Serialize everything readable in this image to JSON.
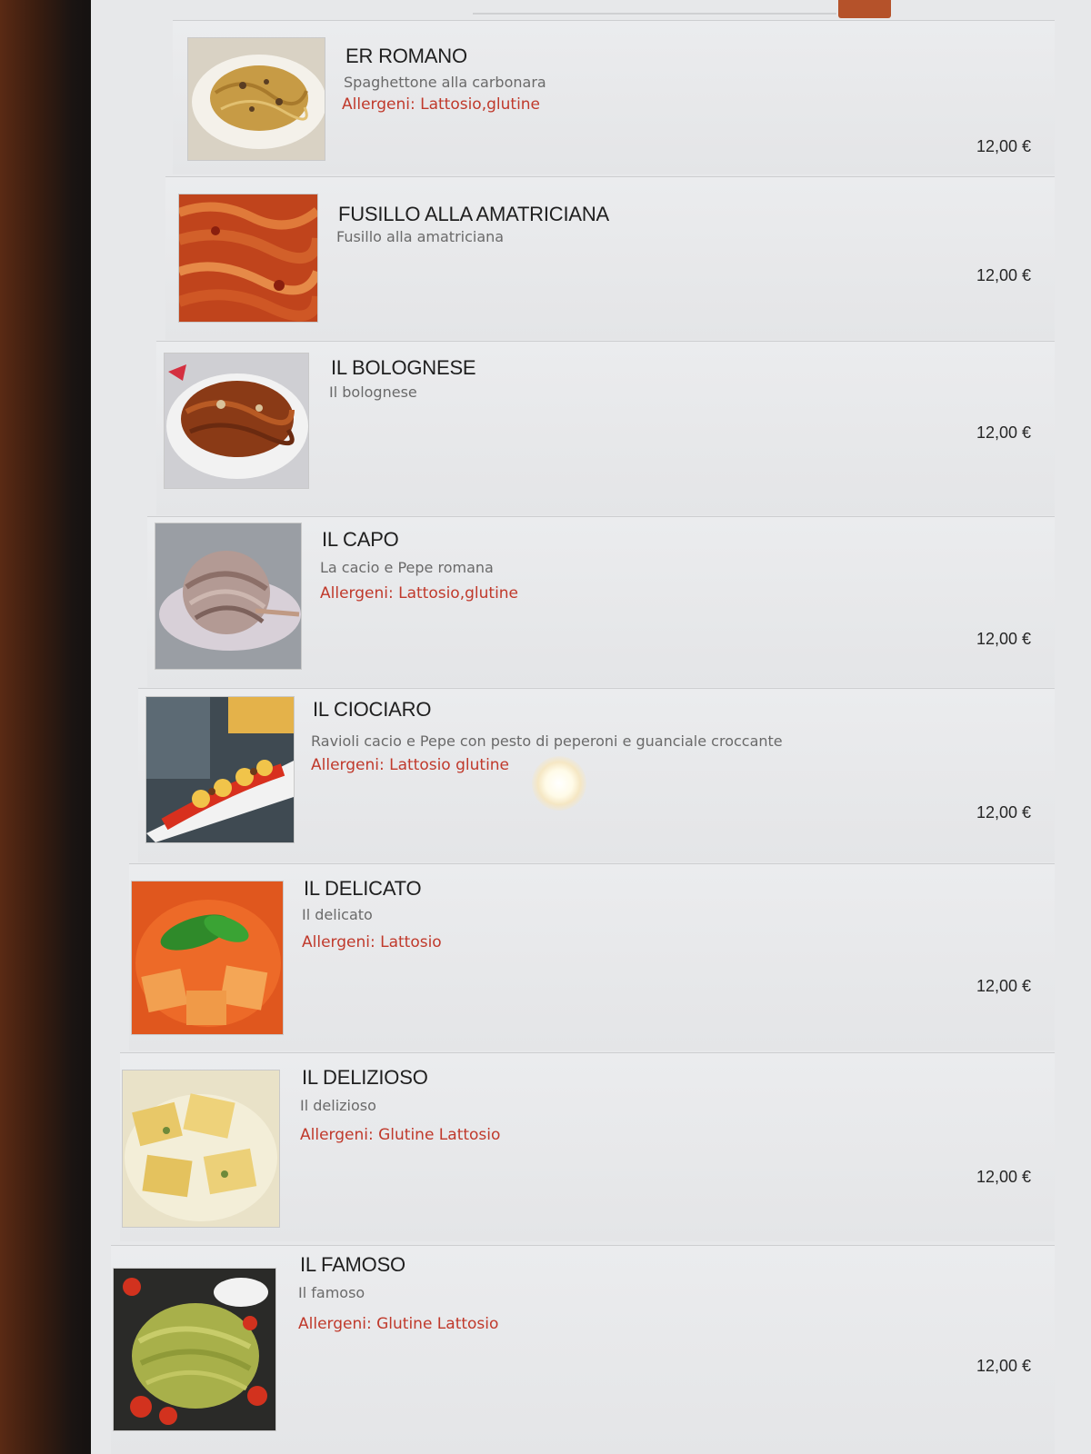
{
  "menu": {
    "items": [
      {
        "name": "ER ROMANO",
        "description": "Spaghettone alla carbonara",
        "allergens": "Allergeni: Lattosio,glutine",
        "price": "12,00 €",
        "image": "spaghetti-carbonara-photo"
      },
      {
        "name": "FUSILLO ALLA AMATRICIANA",
        "description": "Fusillo alla amatriciana",
        "allergens": "",
        "price": "12,00 €",
        "image": "fusilli-amatriciana-photo"
      },
      {
        "name": "IL BOLOGNESE",
        "description": "Il bolognese",
        "allergens": "",
        "price": "12,00 €",
        "image": "tagliatelle-bolognese-photo"
      },
      {
        "name": "IL CAPO",
        "description": "La cacio e Pepe romana",
        "allergens": "Allergeni: Lattosio,glutine",
        "price": "12,00 €",
        "image": "cacio-e-pepe-photo"
      },
      {
        "name": "IL CIOCIARO",
        "description": "Ravioli cacio e Pepe con pesto di peperoni e guanciale croccante",
        "allergens": "Allergeni: Lattosio glutine",
        "price": "12,00 €",
        "image": "ravioli-peperoni-photo"
      },
      {
        "name": "IL DELICATO",
        "description": "Il delicato",
        "allergens": "Allergeni: Lattosio",
        "price": "12,00 €",
        "image": "ravioli-tomato-basil-photo"
      },
      {
        "name": "IL DELIZIOSO",
        "description": "Il delizioso",
        "allergens": "Allergeni: Glutine Lattosio",
        "price": "12,00 €",
        "image": "ravioli-cream-sauce-photo"
      },
      {
        "name": "IL FAMOSO",
        "description": "Il famoso",
        "allergens": "Allergeni: Glutine Lattosio",
        "price": "12,00 €",
        "image": "pesto-pasta-tomatoes-photo"
      }
    ]
  },
  "colors": {
    "allergen_text": "#c0392b",
    "search_button": "#b5522a"
  }
}
